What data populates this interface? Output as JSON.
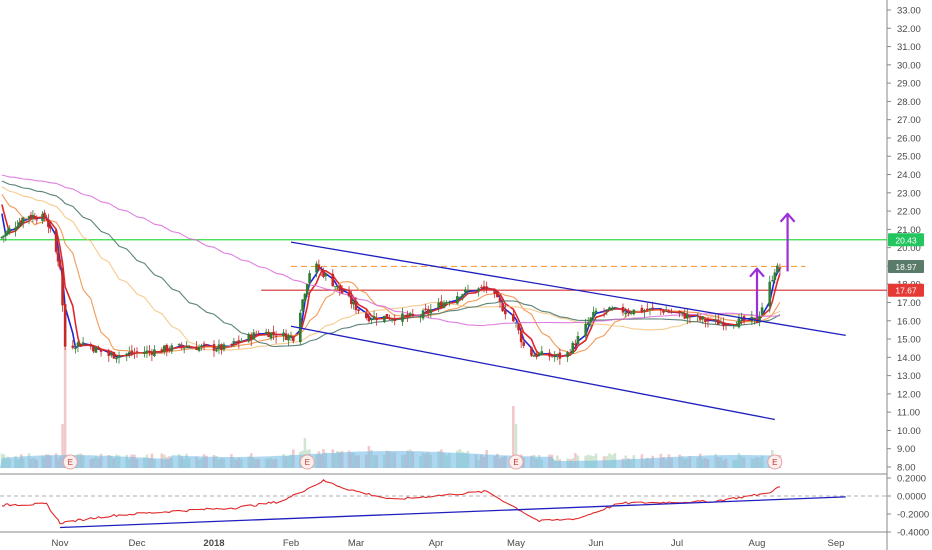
{
  "chart_data": [
    {
      "type": "candlestick",
      "price_axis": {
        "ticks": [
          "33.00",
          "32.00",
          "31.00",
          "30.00",
          "29.00",
          "28.00",
          "27.00",
          "26.00",
          "25.00",
          "24.00",
          "23.00",
          "22.00",
          "21.00",
          "20.00",
          "19.00",
          "18.00",
          "17.00",
          "16.00",
          "15.00",
          "14.00",
          "13.00",
          "12.00",
          "11.00",
          "10.00",
          "9.00",
          "8.00"
        ],
        "range": [
          7.6,
          33.6
        ],
        "scale": "linear"
      },
      "time_axis": {
        "labels": [
          "Nov",
          "Dec",
          "2018",
          "Feb",
          "Mar",
          "Apr",
          "May",
          "Jun",
          "Jul",
          "Aug",
          "Sep"
        ]
      },
      "price_badges": [
        {
          "id": "green",
          "label": "20.43",
          "value": 20.43,
          "color": "#22c55e"
        },
        {
          "id": "last",
          "label": "18.97",
          "value": 18.97,
          "color": "#5a7a6a"
        },
        {
          "id": "red",
          "label": "17.67",
          "value": 17.67,
          "color": "#e53935"
        }
      ],
      "horizontal_lines": [
        {
          "name": "resistance",
          "value": 20.43,
          "color": "#33dd44",
          "style": "solid",
          "span": "full"
        },
        {
          "name": "last-price",
          "value": 18.97,
          "color": "#f5a142",
          "style": "dashed",
          "span": "Feb-Aug"
        },
        {
          "name": "support",
          "value": 17.67,
          "color": "#d32f2f",
          "style": "solid",
          "span": "Jan-Aug"
        }
      ],
      "trend_lines": [
        {
          "name": "channel-top",
          "from": [
            "2018-02-01",
            20.3
          ],
          "to": [
            "2018-09-05",
            15.2
          ],
          "color": "#1f1fbf"
        },
        {
          "name": "channel-bottom",
          "from": [
            "2018-02-01",
            15.7
          ],
          "to": [
            "2018-08-08",
            10.6
          ],
          "color": "#1f1fbf"
        }
      ],
      "arrows": [
        {
          "name": "move-arrow-1",
          "from": [
            "2018-08-01",
            16.1
          ],
          "to": [
            "2018-08-01",
            18.85
          ],
          "color": "#9b30d9"
        },
        {
          "name": "move-arrow-2",
          "from": [
            "2018-08-13",
            18.7
          ],
          "to": [
            "2018-08-13",
            21.85
          ],
          "color": "#9b30d9"
        }
      ],
      "series": [
        {
          "kind": "ohlc",
          "approx_close_path": [
            [
              "2017-10-01",
              20.5
            ],
            [
              "2017-10-15",
              21.8
            ],
            [
              "2017-10-25",
              21.6
            ],
            [
              "2017-11-01",
              19.0
            ],
            [
              "2017-11-03",
              14.6
            ],
            [
              "2017-11-10",
              14.8
            ],
            [
              "2017-11-20",
              14.1
            ],
            [
              "2017-12-05",
              14.3
            ],
            [
              "2017-12-20",
              14.6
            ],
            [
              "2018-01-05",
              14.5
            ],
            [
              "2018-01-20",
              15.4
            ],
            [
              "2018-02-02",
              15.1
            ],
            [
              "2018-02-10",
              19.2
            ],
            [
              "2018-02-18",
              18.2
            ],
            [
              "2018-03-05",
              16.2
            ],
            [
              "2018-03-25",
              16.2
            ],
            [
              "2018-04-10",
              17.5
            ],
            [
              "2018-04-20",
              17.8
            ],
            [
              "2018-05-01",
              15.8
            ],
            [
              "2018-05-05",
              14.2
            ],
            [
              "2018-05-20",
              14.0
            ],
            [
              "2018-06-01",
              16.5
            ],
            [
              "2018-06-25",
              16.6
            ],
            [
              "2018-07-15",
              15.9
            ],
            [
              "2018-08-01",
              16.0
            ],
            [
              "2018-08-08",
              18.8
            ],
            [
              "2018-08-12",
              18.97
            ]
          ]
        }
      ],
      "moving_averages": [
        {
          "color": "#1d27d6"
        },
        {
          "color": "#e0282b"
        },
        {
          "color": "#f08a3a"
        },
        {
          "color": "#f4c27a"
        },
        {
          "color": "#3e6f63"
        },
        {
          "color": "#d96ad9"
        }
      ],
      "volume": {
        "color": "#6cb8e6",
        "earnings_markers": [
          "Nov",
          "Feb",
          "May",
          "Aug"
        ],
        "earnings_label": "E"
      }
    },
    {
      "type": "line",
      "name": "oscillator",
      "y_axis": {
        "ticks": [
          "0.2000",
          "0.0000",
          "-0.2000",
          "-0.4000"
        ],
        "range": [
          -0.46,
          0.34
        ]
      },
      "zero_line": 0.0,
      "color": "#e0282b",
      "trend_line": {
        "from": [
          "2017-11-01",
          -0.35
        ],
        "to": [
          "2018-09-05",
          -0.01
        ],
        "color": "#1f1fbf"
      },
      "approx_path": [
        [
          "2017-10-01",
          -0.1
        ],
        [
          "2017-10-25",
          -0.09
        ],
        [
          "2017-11-01",
          -0.3
        ],
        [
          "2017-11-20",
          -0.22
        ],
        [
          "2017-12-15",
          -0.17
        ],
        [
          "2018-01-10",
          -0.13
        ],
        [
          "2018-01-28",
          -0.06
        ],
        [
          "2018-02-15",
          0.17
        ],
        [
          "2018-02-25",
          0.08
        ],
        [
          "2018-03-15",
          -0.04
        ],
        [
          "2018-04-20",
          0.05
        ],
        [
          "2018-05-10",
          -0.28
        ],
        [
          "2018-05-25",
          -0.25
        ],
        [
          "2018-06-10",
          -0.08
        ],
        [
          "2018-07-15",
          -0.06
        ],
        [
          "2018-08-05",
          0.03
        ],
        [
          "2018-08-12",
          0.13
        ]
      ]
    }
  ],
  "colors": {
    "axis_border": "#888888",
    "grid": "#e8e8e8",
    "up_candle": "#2e7d32",
    "down_candle": "#c62828"
  }
}
